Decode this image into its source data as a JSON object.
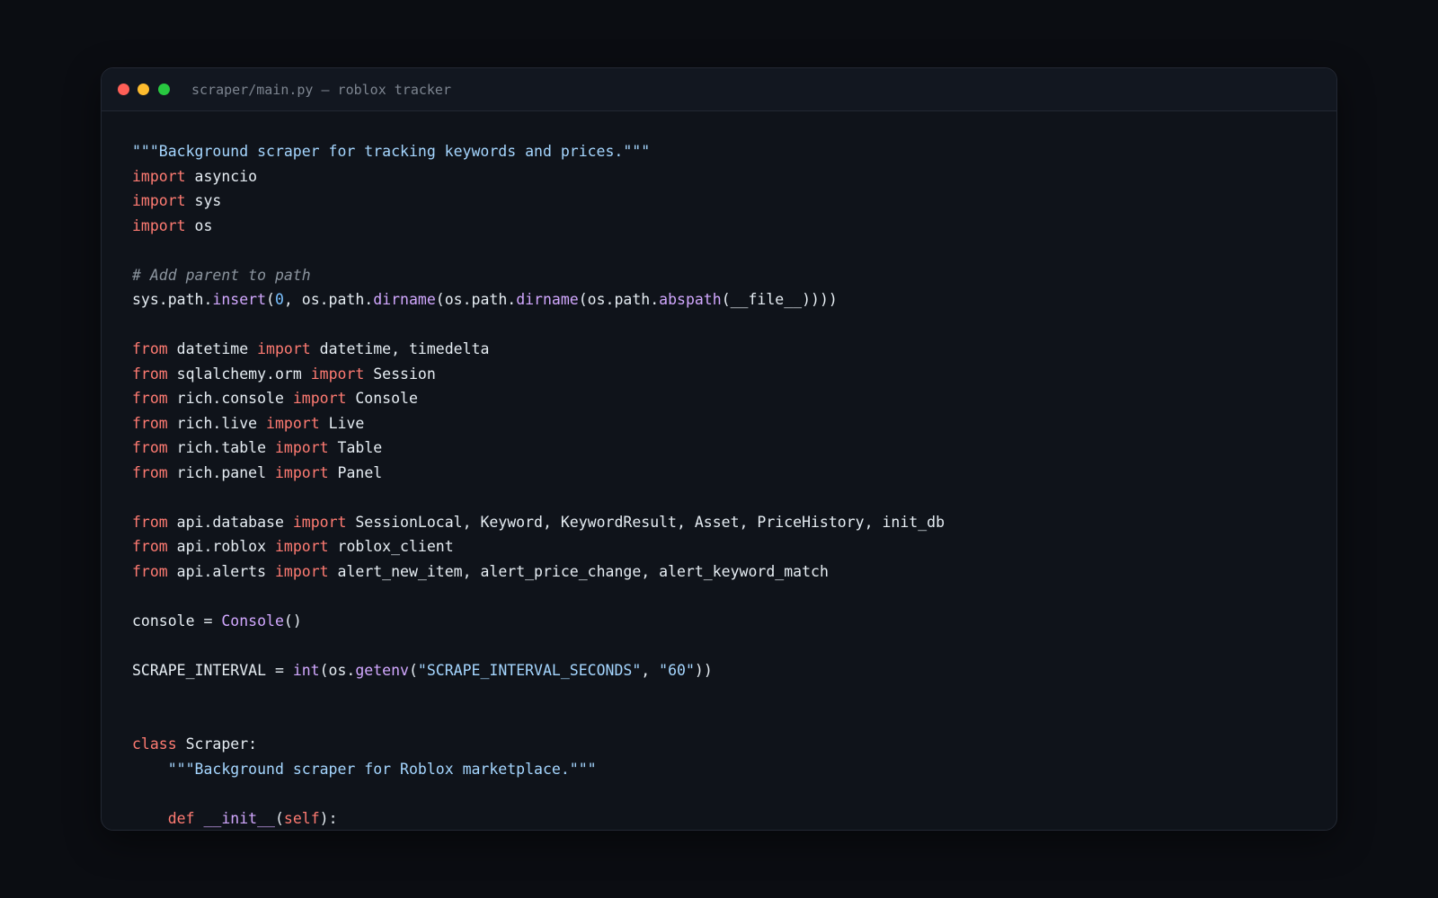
{
  "window": {
    "title": "scraper/main.py — roblox tracker"
  },
  "colors": {
    "keyword": "#ff7b72",
    "string": "#a5d6ff",
    "comment": "#8b949e",
    "function": "#d2a8ff",
    "number": "#79c0ff",
    "text": "#e6edf3",
    "close": "#ff5f57",
    "minimize": "#febc2e",
    "maximize": "#28c840"
  },
  "code": {
    "lines": [
      [
        {
          "t": "str",
          "v": "\"\"\"Background scraper for tracking keywords and prices.\"\"\""
        }
      ],
      [
        {
          "t": "kw",
          "v": "import"
        },
        {
          "t": "id",
          "v": " asyncio"
        }
      ],
      [
        {
          "t": "kw",
          "v": "import"
        },
        {
          "t": "id",
          "v": " sys"
        }
      ],
      [
        {
          "t": "kw",
          "v": "import"
        },
        {
          "t": "id",
          "v": " os"
        }
      ],
      [],
      [
        {
          "t": "cm",
          "v": "# Add parent to path"
        }
      ],
      [
        {
          "t": "id",
          "v": "sys.path."
        },
        {
          "t": "fn",
          "v": "insert"
        },
        {
          "t": "id",
          "v": "("
        },
        {
          "t": "num",
          "v": "0"
        },
        {
          "t": "id",
          "v": ", os.path."
        },
        {
          "t": "fn",
          "v": "dirname"
        },
        {
          "t": "id",
          "v": "(os.path."
        },
        {
          "t": "fn",
          "v": "dirname"
        },
        {
          "t": "id",
          "v": "(os.path."
        },
        {
          "t": "fn",
          "v": "abspath"
        },
        {
          "t": "id",
          "v": "(__file__))))"
        }
      ],
      [],
      [
        {
          "t": "kw",
          "v": "from"
        },
        {
          "t": "id",
          "v": " datetime "
        },
        {
          "t": "kw",
          "v": "import"
        },
        {
          "t": "id",
          "v": " datetime, timedelta"
        }
      ],
      [
        {
          "t": "kw",
          "v": "from"
        },
        {
          "t": "id",
          "v": " sqlalchemy.orm "
        },
        {
          "t": "kw",
          "v": "import"
        },
        {
          "t": "id",
          "v": " Session"
        }
      ],
      [
        {
          "t": "kw",
          "v": "from"
        },
        {
          "t": "id",
          "v": " rich.console "
        },
        {
          "t": "kw",
          "v": "import"
        },
        {
          "t": "id",
          "v": " Console"
        }
      ],
      [
        {
          "t": "kw",
          "v": "from"
        },
        {
          "t": "id",
          "v": " rich.live "
        },
        {
          "t": "kw",
          "v": "import"
        },
        {
          "t": "id",
          "v": " Live"
        }
      ],
      [
        {
          "t": "kw",
          "v": "from"
        },
        {
          "t": "id",
          "v": " rich.table "
        },
        {
          "t": "kw",
          "v": "import"
        },
        {
          "t": "id",
          "v": " Table"
        }
      ],
      [
        {
          "t": "kw",
          "v": "from"
        },
        {
          "t": "id",
          "v": " rich.panel "
        },
        {
          "t": "kw",
          "v": "import"
        },
        {
          "t": "id",
          "v": " Panel"
        }
      ],
      [],
      [
        {
          "t": "kw",
          "v": "from"
        },
        {
          "t": "id",
          "v": " api.database "
        },
        {
          "t": "kw",
          "v": "import"
        },
        {
          "t": "id",
          "v": " SessionLocal, Keyword, KeywordResult, Asset, PriceHistory, init_db"
        }
      ],
      [
        {
          "t": "kw",
          "v": "from"
        },
        {
          "t": "id",
          "v": " api.roblox "
        },
        {
          "t": "kw",
          "v": "import"
        },
        {
          "t": "id",
          "v": " roblox_client"
        }
      ],
      [
        {
          "t": "kw",
          "v": "from"
        },
        {
          "t": "id",
          "v": " api.alerts "
        },
        {
          "t": "kw",
          "v": "import"
        },
        {
          "t": "id",
          "v": " alert_new_item, alert_price_change, alert_keyword_match"
        }
      ],
      [],
      [
        {
          "t": "id",
          "v": "console = "
        },
        {
          "t": "fn",
          "v": "Console"
        },
        {
          "t": "id",
          "v": "()"
        }
      ],
      [],
      [
        {
          "t": "id",
          "v": "SCRAPE_INTERVAL = "
        },
        {
          "t": "fn",
          "v": "int"
        },
        {
          "t": "id",
          "v": "(os."
        },
        {
          "t": "fn",
          "v": "getenv"
        },
        {
          "t": "id",
          "v": "("
        },
        {
          "t": "str",
          "v": "\"SCRAPE_INTERVAL_SECONDS\""
        },
        {
          "t": "id",
          "v": ", "
        },
        {
          "t": "str",
          "v": "\"60\""
        },
        {
          "t": "id",
          "v": "))"
        }
      ],
      [],
      [],
      [
        {
          "t": "kw",
          "v": "class"
        },
        {
          "t": "id",
          "v": " Scraper:"
        }
      ],
      [
        {
          "t": "id",
          "v": "    "
        },
        {
          "t": "str",
          "v": "\"\"\"Background scraper for Roblox marketplace.\"\"\""
        }
      ],
      [],
      [
        {
          "t": "id",
          "v": "    "
        },
        {
          "t": "kw",
          "v": "def"
        },
        {
          "t": "id",
          "v": " "
        },
        {
          "t": "fn",
          "v": "__init__"
        },
        {
          "t": "id",
          "v": "("
        },
        {
          "t": "self",
          "v": "self"
        },
        {
          "t": "id",
          "v": "):"
        }
      ]
    ]
  }
}
